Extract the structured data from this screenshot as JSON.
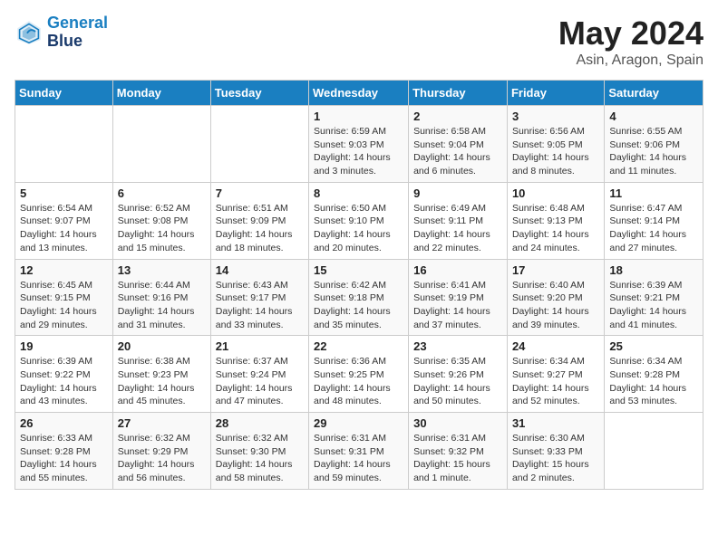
{
  "header": {
    "logo_line1": "General",
    "logo_line2": "Blue",
    "month": "May 2024",
    "location": "Asin, Aragon, Spain"
  },
  "weekdays": [
    "Sunday",
    "Monday",
    "Tuesday",
    "Wednesday",
    "Thursday",
    "Friday",
    "Saturday"
  ],
  "weeks": [
    [
      {
        "day": "",
        "detail": ""
      },
      {
        "day": "",
        "detail": ""
      },
      {
        "day": "",
        "detail": ""
      },
      {
        "day": "1",
        "detail": "Sunrise: 6:59 AM\nSunset: 9:03 PM\nDaylight: 14 hours\nand 3 minutes."
      },
      {
        "day": "2",
        "detail": "Sunrise: 6:58 AM\nSunset: 9:04 PM\nDaylight: 14 hours\nand 6 minutes."
      },
      {
        "day": "3",
        "detail": "Sunrise: 6:56 AM\nSunset: 9:05 PM\nDaylight: 14 hours\nand 8 minutes."
      },
      {
        "day": "4",
        "detail": "Sunrise: 6:55 AM\nSunset: 9:06 PM\nDaylight: 14 hours\nand 11 minutes."
      }
    ],
    [
      {
        "day": "5",
        "detail": "Sunrise: 6:54 AM\nSunset: 9:07 PM\nDaylight: 14 hours\nand 13 minutes."
      },
      {
        "day": "6",
        "detail": "Sunrise: 6:52 AM\nSunset: 9:08 PM\nDaylight: 14 hours\nand 15 minutes."
      },
      {
        "day": "7",
        "detail": "Sunrise: 6:51 AM\nSunset: 9:09 PM\nDaylight: 14 hours\nand 18 minutes."
      },
      {
        "day": "8",
        "detail": "Sunrise: 6:50 AM\nSunset: 9:10 PM\nDaylight: 14 hours\nand 20 minutes."
      },
      {
        "day": "9",
        "detail": "Sunrise: 6:49 AM\nSunset: 9:11 PM\nDaylight: 14 hours\nand 22 minutes."
      },
      {
        "day": "10",
        "detail": "Sunrise: 6:48 AM\nSunset: 9:13 PM\nDaylight: 14 hours\nand 24 minutes."
      },
      {
        "day": "11",
        "detail": "Sunrise: 6:47 AM\nSunset: 9:14 PM\nDaylight: 14 hours\nand 27 minutes."
      }
    ],
    [
      {
        "day": "12",
        "detail": "Sunrise: 6:45 AM\nSunset: 9:15 PM\nDaylight: 14 hours\nand 29 minutes."
      },
      {
        "day": "13",
        "detail": "Sunrise: 6:44 AM\nSunset: 9:16 PM\nDaylight: 14 hours\nand 31 minutes."
      },
      {
        "day": "14",
        "detail": "Sunrise: 6:43 AM\nSunset: 9:17 PM\nDaylight: 14 hours\nand 33 minutes."
      },
      {
        "day": "15",
        "detail": "Sunrise: 6:42 AM\nSunset: 9:18 PM\nDaylight: 14 hours\nand 35 minutes."
      },
      {
        "day": "16",
        "detail": "Sunrise: 6:41 AM\nSunset: 9:19 PM\nDaylight: 14 hours\nand 37 minutes."
      },
      {
        "day": "17",
        "detail": "Sunrise: 6:40 AM\nSunset: 9:20 PM\nDaylight: 14 hours\nand 39 minutes."
      },
      {
        "day": "18",
        "detail": "Sunrise: 6:39 AM\nSunset: 9:21 PM\nDaylight: 14 hours\nand 41 minutes."
      }
    ],
    [
      {
        "day": "19",
        "detail": "Sunrise: 6:39 AM\nSunset: 9:22 PM\nDaylight: 14 hours\nand 43 minutes."
      },
      {
        "day": "20",
        "detail": "Sunrise: 6:38 AM\nSunset: 9:23 PM\nDaylight: 14 hours\nand 45 minutes."
      },
      {
        "day": "21",
        "detail": "Sunrise: 6:37 AM\nSunset: 9:24 PM\nDaylight: 14 hours\nand 47 minutes."
      },
      {
        "day": "22",
        "detail": "Sunrise: 6:36 AM\nSunset: 9:25 PM\nDaylight: 14 hours\nand 48 minutes."
      },
      {
        "day": "23",
        "detail": "Sunrise: 6:35 AM\nSunset: 9:26 PM\nDaylight: 14 hours\nand 50 minutes."
      },
      {
        "day": "24",
        "detail": "Sunrise: 6:34 AM\nSunset: 9:27 PM\nDaylight: 14 hours\nand 52 minutes."
      },
      {
        "day": "25",
        "detail": "Sunrise: 6:34 AM\nSunset: 9:28 PM\nDaylight: 14 hours\nand 53 minutes."
      }
    ],
    [
      {
        "day": "26",
        "detail": "Sunrise: 6:33 AM\nSunset: 9:28 PM\nDaylight: 14 hours\nand 55 minutes."
      },
      {
        "day": "27",
        "detail": "Sunrise: 6:32 AM\nSunset: 9:29 PM\nDaylight: 14 hours\nand 56 minutes."
      },
      {
        "day": "28",
        "detail": "Sunrise: 6:32 AM\nSunset: 9:30 PM\nDaylight: 14 hours\nand 58 minutes."
      },
      {
        "day": "29",
        "detail": "Sunrise: 6:31 AM\nSunset: 9:31 PM\nDaylight: 14 hours\nand 59 minutes."
      },
      {
        "day": "30",
        "detail": "Sunrise: 6:31 AM\nSunset: 9:32 PM\nDaylight: 15 hours\nand 1 minute."
      },
      {
        "day": "31",
        "detail": "Sunrise: 6:30 AM\nSunset: 9:33 PM\nDaylight: 15 hours\nand 2 minutes."
      },
      {
        "day": "",
        "detail": ""
      }
    ]
  ]
}
